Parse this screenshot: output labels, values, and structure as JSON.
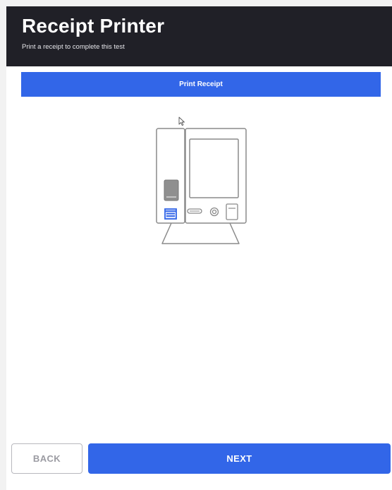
{
  "header": {
    "title": "Receipt Printer",
    "subtitle": "Print a receipt to complete this test"
  },
  "actions": {
    "print_label": "Print Receipt"
  },
  "footer": {
    "back_label": "BACK",
    "next_label": "NEXT"
  },
  "colors": {
    "header_bg": "#202027",
    "accent": "#3266e8",
    "illustration_stroke": "#8a8a8a",
    "printer_highlight": "#3266e8"
  },
  "icons": {
    "illustration": "voting-machine-illustration",
    "cursor": "mouse-pointer-icon"
  }
}
